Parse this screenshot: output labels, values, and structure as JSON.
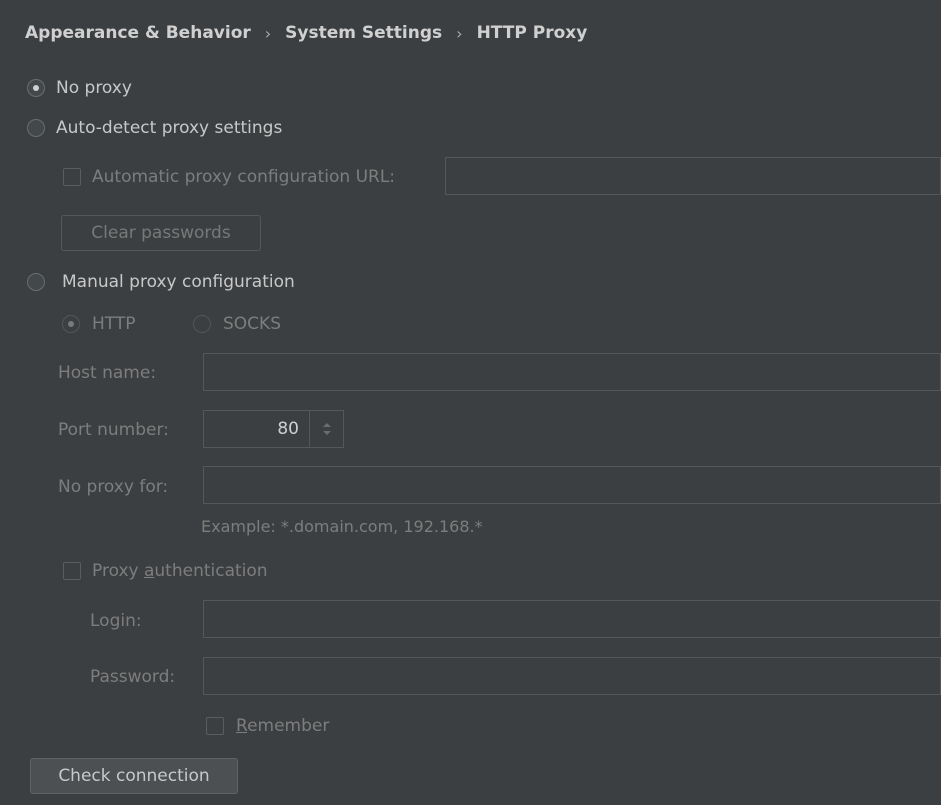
{
  "breadcrumb": {
    "items": [
      "Appearance & Behavior",
      "System Settings",
      "HTTP Proxy"
    ]
  },
  "proxy_mode": {
    "no_proxy": "No proxy",
    "auto_detect": "Auto-detect proxy settings",
    "manual": "Manual proxy configuration",
    "selected": "No proxy"
  },
  "auto_config": {
    "checkbox_label": "Automatic proxy configuration URL:",
    "url_value": "",
    "clear_passwords": "Clear passwords"
  },
  "manual": {
    "type_http": "HTTP",
    "type_socks": "SOCKS",
    "host_label": "Host name:",
    "host_value": "",
    "port_label": "Port number:",
    "port_value": "80",
    "no_proxy_label": "No proxy for:",
    "no_proxy_value": "",
    "example": "Example: *.domain.com, 192.168.*"
  },
  "auth": {
    "checkbox_label_pre": "Proxy ",
    "checkbox_label_mnemonic": "a",
    "checkbox_label_post": "uthentication",
    "login_label": "Login:",
    "login_value": "",
    "password_label": "Password:",
    "password_value": "",
    "remember_mnemonic": "R",
    "remember_rest": "emember"
  },
  "actions": {
    "check_connection": "Check connection"
  },
  "colors": {
    "background": "#3c3f41",
    "text_enabled": "#c8c8c8",
    "text_disabled": "#7d7d7d"
  }
}
